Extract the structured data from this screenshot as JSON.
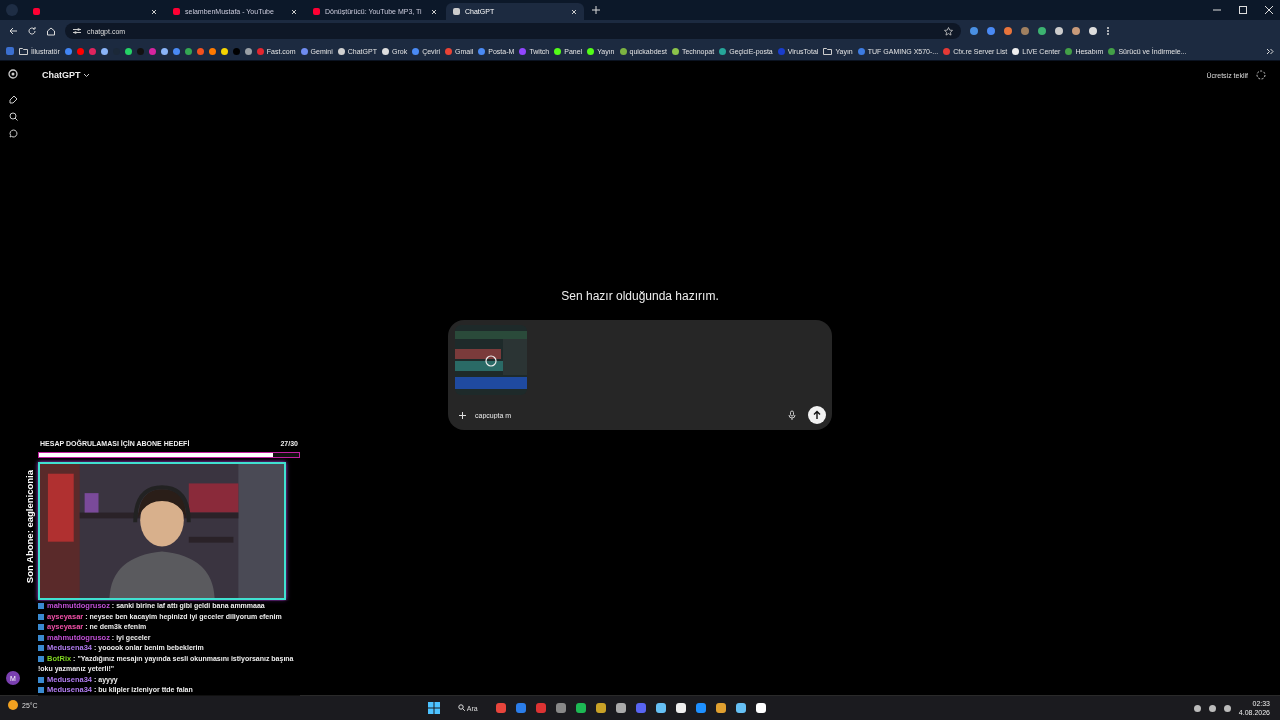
{
  "tabs": [
    {
      "selected": false
    },
    {
      "title": "selambenMustafa - YouTube",
      "selected": false
    },
    {
      "title": "Dönüştürücü: YouTube MP3, Ti",
      "selected": false
    },
    {
      "title": "ChatGPT",
      "selected": true
    }
  ],
  "address": {
    "url": "chatgpt.com"
  },
  "bookmarks": [
    {
      "kind": "folder",
      "label": "İllustratör"
    },
    {
      "kind": "site",
      "color": "#4285f4"
    },
    {
      "kind": "site",
      "color": "#ff0000"
    },
    {
      "kind": "site",
      "color": "#e0245e"
    },
    {
      "kind": "site",
      "color": "#8ab4f8"
    },
    {
      "kind": "site",
      "color": "#1b2838"
    },
    {
      "kind": "site",
      "color": "#25d366"
    },
    {
      "kind": "site",
      "color": "#111111"
    },
    {
      "kind": "site",
      "color": "#d6249f"
    },
    {
      "kind": "site",
      "color": "#8ab4f8"
    },
    {
      "kind": "site",
      "color": "#4a8af4"
    },
    {
      "kind": "site",
      "color": "#34a853"
    },
    {
      "kind": "site",
      "color": "#f4511e"
    },
    {
      "kind": "site",
      "color": "#ff7a00"
    },
    {
      "kind": "site",
      "color": "#f5d400"
    },
    {
      "kind": "site",
      "color": "#000000"
    },
    {
      "kind": "site",
      "color": "#9aa0a6"
    },
    {
      "kind": "site",
      "color": "#e3262e",
      "label": "Fast.com"
    },
    {
      "kind": "site",
      "color": "#6f8cf0",
      "label": "Gemini"
    },
    {
      "kind": "site",
      "color": "#d0d0d0",
      "label": "ChatGPT"
    },
    {
      "kind": "site",
      "color": "#dddddd",
      "label": "Grok"
    },
    {
      "kind": "site",
      "color": "#4a8af4",
      "label": "Çeviri"
    },
    {
      "kind": "site",
      "color": "#ea4335",
      "label": "Gmail"
    },
    {
      "kind": "site",
      "color": "#4a8af4",
      "label": "Posta-M"
    },
    {
      "kind": "site",
      "color": "#9146ff",
      "label": "Twitch"
    },
    {
      "kind": "site",
      "color": "#53fc18",
      "label": "Panel"
    },
    {
      "kind": "site",
      "color": "#53fc18",
      "label": "Yayın"
    },
    {
      "kind": "site",
      "color": "#7cb342",
      "label": "quickabdest"
    },
    {
      "kind": "site",
      "color": "#8bc34a",
      "label": "Technopat"
    },
    {
      "kind": "site",
      "color": "#26a69a",
      "label": "GeçiciE-posta"
    },
    {
      "kind": "site",
      "color": "#1a3dcc",
      "label": "VirusTotal"
    },
    {
      "kind": "folder",
      "label": "Yayın"
    },
    {
      "kind": "site",
      "color": "#3d7be0",
      "label": "TUF GAMING X570-..."
    },
    {
      "kind": "site",
      "color": "#e53935",
      "label": "Cfx.re Server List"
    },
    {
      "kind": "site",
      "color": "#eeeeee",
      "label": "LIVE Center"
    },
    {
      "kind": "site",
      "color": "#43a047",
      "label": "Hesabım"
    },
    {
      "kind": "site",
      "color": "#43a047",
      "label": "Sürücü ve İndirmele..."
    }
  ],
  "header": {
    "title": "ChatGPT",
    "offer": "Ücretsiz teklif"
  },
  "headline": "Sen hazır olduğunda hazırım.",
  "composer": {
    "value": "capcupta m"
  },
  "avatar": {
    "initial": "M"
  },
  "overlay": {
    "goal_title": "HESAP DOĞRULAMASI İÇİN ABONE HEDEFİ",
    "goal_count": "27/30",
    "level": 0.9,
    "last_sub": "Son Abone: eagleniconia"
  },
  "chat": [
    {
      "user": "mahmutdogrusoz",
      "color": "#c04fd6",
      "text": ": sanki birine laf attı gibi geldi bana ammmaaa"
    },
    {
      "user": "ayseyasar",
      "color": "#f050a8",
      "text": ": neysee ben kacayim hepinizd iyi geceler diliyorum efenim"
    },
    {
      "user": "ayseyasar",
      "color": "#f050a8",
      "text": ": ne dem3k efenim"
    },
    {
      "user": "mahmutdogrusoz",
      "color": "#c04fd6",
      "text": ": iyi geceler"
    },
    {
      "user": "Medusena34",
      "color": "#b07cf0",
      "text": ": yooook onlar benim bebeklerim"
    },
    {
      "user": "BotRix",
      "color": "#7ed321",
      "text": ": \"Yazdığınız mesajın yayında sesli okunmasını istiyorsanız başına !oku yazmanız yeterli!\""
    },
    {
      "user": "Medusena34",
      "color": "#b07cf0",
      "text": ": ayyyy"
    },
    {
      "user": "Medusena34",
      "color": "#b07cf0",
      "text": ": bu klipler izleniyor ttde falan"
    }
  ],
  "taskbar": {
    "search": "Ara",
    "weather": "25°C",
    "time": "02:33",
    "date": "4.08.2026"
  }
}
